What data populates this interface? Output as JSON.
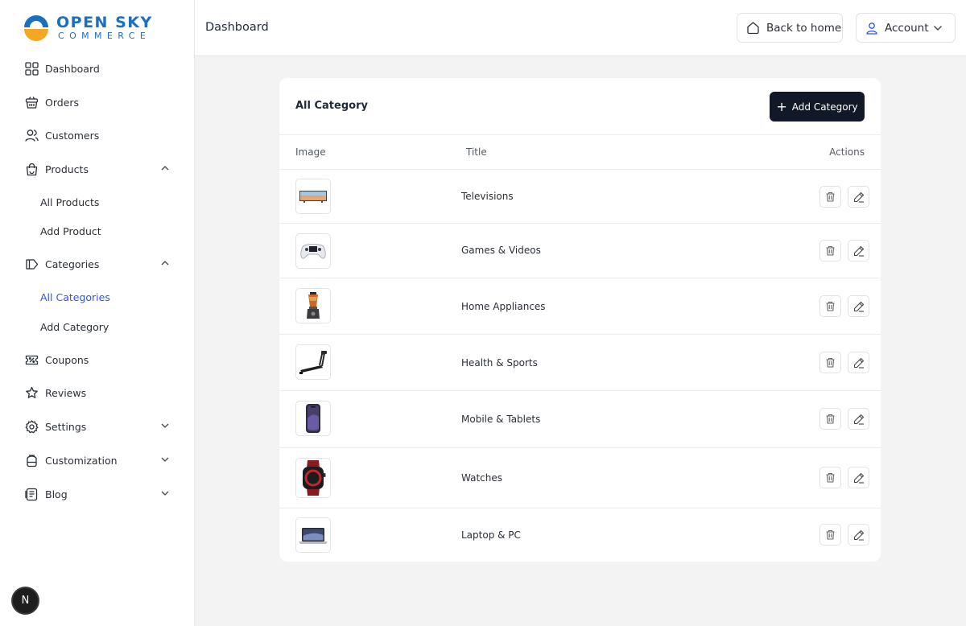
{
  "brand": {
    "title": "OPEN SKY",
    "subtitle": "COMMERCE"
  },
  "colors": {
    "brand_blue": "#1b6fc0",
    "brand_orange": "#f5a623",
    "active_link": "#2f54eb",
    "primary_button": "#111827"
  },
  "sidebar": {
    "items": [
      {
        "label": "Dashboard",
        "icon": "grid-icon"
      },
      {
        "label": "Orders",
        "icon": "basket-icon"
      },
      {
        "label": "Customers",
        "icon": "users-icon"
      },
      {
        "label": "Products",
        "icon": "shopping-bag-icon",
        "expanded": true
      },
      {
        "label": "Categories",
        "icon": "tag-icon",
        "expanded": true
      },
      {
        "label": "Coupons",
        "icon": "ticket-icon"
      },
      {
        "label": "Reviews",
        "icon": "star-badge-icon"
      },
      {
        "label": "Settings",
        "icon": "gear-icon",
        "expanded": false
      },
      {
        "label": "Customization",
        "icon": "paint-icon",
        "expanded": false
      },
      {
        "label": "Blog",
        "icon": "document-icon",
        "expanded": false
      }
    ],
    "products_sub": [
      "All Products",
      "Add Product"
    ],
    "categories_sub": [
      "All Categories",
      "Add Category"
    ],
    "active_sub": "All Categories"
  },
  "header": {
    "page_title": "Dashboard",
    "back_home": "Back to home",
    "account": "Account"
  },
  "badge": {
    "letter": "N"
  },
  "card": {
    "title": "All Category",
    "add_button": "Add Category",
    "columns": [
      "Image",
      "Title",
      "Actions"
    ],
    "rows": [
      {
        "title": "Televisions",
        "image": "television-image"
      },
      {
        "title": "Games & Videos",
        "image": "game-controller-image"
      },
      {
        "title": "Home Appliances",
        "image": "blender-image"
      },
      {
        "title": "Health & Sports",
        "image": "treadmill-image"
      },
      {
        "title": "Mobile & Tablets",
        "image": "smartphone-image"
      },
      {
        "title": "Watches",
        "image": "smartwatch-image"
      },
      {
        "title": "Laptop & PC",
        "image": "laptop-image"
      }
    ]
  }
}
